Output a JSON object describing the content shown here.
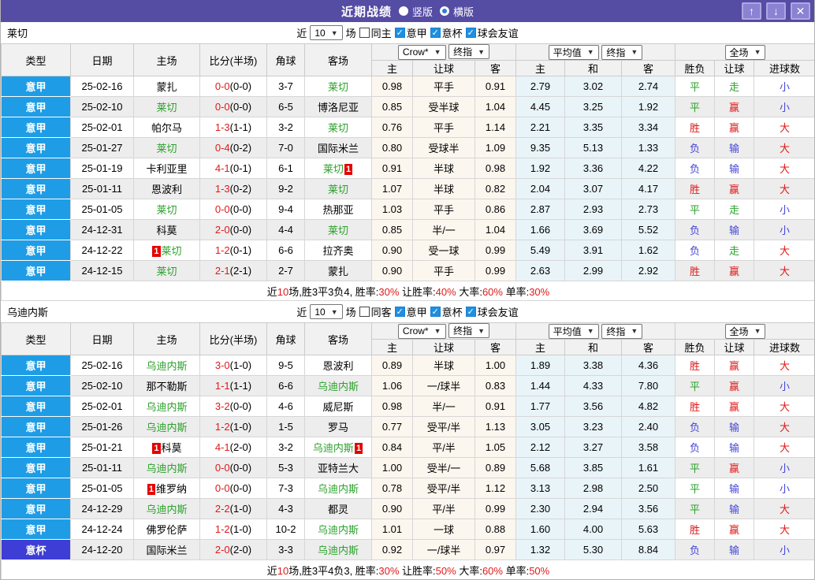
{
  "titlebar": {
    "title": "近期战绩",
    "vertical_label": "竖版",
    "horizontal_label": "横版",
    "icons": {
      "up": "↑",
      "down": "↓",
      "close": "✕"
    },
    "bar_color": "#554ca4",
    "button_color": "#8a82d2"
  },
  "colors": {
    "league_serie_a": "#1e9de6",
    "league_cup": "#3e3ed6",
    "odds_bg": "#fcf7ee",
    "avg_bg": "#e9f4f9",
    "win_red": "#e01919",
    "draw_green": "#2ba12b",
    "lose_blue": "#4545d6"
  },
  "columns": {
    "type": "类型",
    "date": "日期",
    "home": "主场",
    "score": "比分(半场)",
    "corner": "角球",
    "away": "客场",
    "odds_home": "主",
    "handicap": "让球",
    "odds_away": "客",
    "avg_home": "主",
    "avg_draw": "和",
    "avg_away": "客",
    "result": "胜负",
    "handicap_result": "让球",
    "goals": "进球数"
  },
  "tables": [
    {
      "team": "莱切",
      "filter": {
        "near_label": "近",
        "matches_count": "10",
        "games_label": "场",
        "same_venue_label": "同主",
        "leagues": [
          {
            "label": "意甲"
          },
          {
            "label": "意杯"
          },
          {
            "label": "球会友谊"
          }
        ]
      },
      "selects": {
        "company": "Crow*",
        "company_ref": "终指",
        "avg": "平均值",
        "avg_ref": "终指",
        "scope": "全场"
      },
      "rows": [
        {
          "league": "意甲",
          "league_type": "main",
          "date": "25-02-16",
          "home": {
            "name": "蒙扎"
          },
          "score_ft": "0-0",
          "score_ht": "(0-0)",
          "corner": "3-7",
          "away": {
            "name": "莱切",
            "green": true
          },
          "odds": [
            "0.98",
            "平手",
            "0.91"
          ],
          "avg": [
            "2.79",
            "3.02",
            "2.74"
          ],
          "results": [
            {
              "t": "平",
              "c": "green"
            },
            {
              "t": "走",
              "c": "green"
            },
            {
              "t": "小",
              "c": "blue"
            }
          ]
        },
        {
          "league": "意甲",
          "league_type": "main",
          "date": "25-02-10",
          "home": {
            "name": "莱切",
            "green": true
          },
          "score_ft": "0-0",
          "score_ht": "(0-0)",
          "corner": "6-5",
          "away": {
            "name": "博洛尼亚"
          },
          "odds": [
            "0.85",
            "受半球",
            "1.04"
          ],
          "avg": [
            "4.45",
            "3.25",
            "1.92"
          ],
          "results": [
            {
              "t": "平",
              "c": "green"
            },
            {
              "t": "赢",
              "c": "red"
            },
            {
              "t": "小",
              "c": "blue"
            }
          ]
        },
        {
          "league": "意甲",
          "league_type": "main",
          "date": "25-02-01",
          "home": {
            "name": "帕尔马"
          },
          "score_ft": "1-3",
          "score_ht": "(1-1)",
          "corner": "3-2",
          "away": {
            "name": "莱切",
            "green": true
          },
          "odds": [
            "0.76",
            "平手",
            "1.14"
          ],
          "avg": [
            "2.21",
            "3.35",
            "3.34"
          ],
          "results": [
            {
              "t": "胜",
              "c": "red"
            },
            {
              "t": "赢",
              "c": "red"
            },
            {
              "t": "大",
              "c": "red"
            }
          ]
        },
        {
          "league": "意甲",
          "league_type": "main",
          "date": "25-01-27",
          "home": {
            "name": "莱切",
            "green": true
          },
          "score_ft": "0-4",
          "score_ht": "(0-2)",
          "corner": "7-0",
          "away": {
            "name": "国际米兰"
          },
          "odds": [
            "0.80",
            "受球半",
            "1.09"
          ],
          "avg": [
            "9.35",
            "5.13",
            "1.33"
          ],
          "results": [
            {
              "t": "负",
              "c": "blue"
            },
            {
              "t": "输",
              "c": "blue"
            },
            {
              "t": "大",
              "c": "red"
            }
          ]
        },
        {
          "league": "意甲",
          "league_type": "main",
          "date": "25-01-19",
          "home": {
            "name": "卡利亚里"
          },
          "score_ft": "4-1",
          "score_ht": "(0-1)",
          "corner": "6-1",
          "away": {
            "name": "莱切",
            "green": true,
            "card": "1"
          },
          "odds": [
            "0.91",
            "半球",
            "0.98"
          ],
          "avg": [
            "1.92",
            "3.36",
            "4.22"
          ],
          "results": [
            {
              "t": "负",
              "c": "blue"
            },
            {
              "t": "输",
              "c": "blue"
            },
            {
              "t": "大",
              "c": "red"
            }
          ]
        },
        {
          "league": "意甲",
          "league_type": "main",
          "date": "25-01-11",
          "home": {
            "name": "恩波利"
          },
          "score_ft": "1-3",
          "score_ht": "(0-2)",
          "corner": "9-2",
          "away": {
            "name": "莱切",
            "green": true
          },
          "odds": [
            "1.07",
            "半球",
            "0.82"
          ],
          "avg": [
            "2.04",
            "3.07",
            "4.17"
          ],
          "results": [
            {
              "t": "胜",
              "c": "red"
            },
            {
              "t": "赢",
              "c": "red"
            },
            {
              "t": "大",
              "c": "red"
            }
          ]
        },
        {
          "league": "意甲",
          "league_type": "main",
          "date": "25-01-05",
          "home": {
            "name": "莱切",
            "green": true
          },
          "score_ft": "0-0",
          "score_ht": "(0-0)",
          "corner": "9-4",
          "away": {
            "name": "热那亚"
          },
          "odds": [
            "1.03",
            "平手",
            "0.86"
          ],
          "avg": [
            "2.87",
            "2.93",
            "2.73"
          ],
          "results": [
            {
              "t": "平",
              "c": "green"
            },
            {
              "t": "走",
              "c": "green"
            },
            {
              "t": "小",
              "c": "blue"
            }
          ]
        },
        {
          "league": "意甲",
          "league_type": "main",
          "date": "24-12-31",
          "home": {
            "name": "科莫"
          },
          "score_ft": "2-0",
          "score_ht": "(0-0)",
          "corner": "4-4",
          "away": {
            "name": "莱切",
            "green": true
          },
          "odds": [
            "0.85",
            "半/一",
            "1.04"
          ],
          "avg": [
            "1.66",
            "3.69",
            "5.52"
          ],
          "results": [
            {
              "t": "负",
              "c": "blue"
            },
            {
              "t": "输",
              "c": "blue"
            },
            {
              "t": "小",
              "c": "blue"
            }
          ]
        },
        {
          "league": "意甲",
          "league_type": "main",
          "date": "24-12-22",
          "home": {
            "name": "莱切",
            "green": true,
            "card": "1"
          },
          "score_ft": "1-2",
          "score_ht": "(0-1)",
          "corner": "6-6",
          "away": {
            "name": "拉齐奥"
          },
          "odds": [
            "0.90",
            "受一球",
            "0.99"
          ],
          "avg": [
            "5.49",
            "3.91",
            "1.62"
          ],
          "results": [
            {
              "t": "负",
              "c": "blue"
            },
            {
              "t": "走",
              "c": "green"
            },
            {
              "t": "大",
              "c": "red"
            }
          ]
        },
        {
          "league": "意甲",
          "league_type": "main",
          "date": "24-12-15",
          "home": {
            "name": "莱切",
            "green": true
          },
          "score_ft": "2-1",
          "score_ht": "(2-1)",
          "corner": "2-7",
          "away": {
            "name": "蒙扎"
          },
          "odds": [
            "0.90",
            "平手",
            "0.99"
          ],
          "avg": [
            "2.63",
            "2.99",
            "2.92"
          ],
          "results": [
            {
              "t": "胜",
              "c": "red"
            },
            {
              "t": "赢",
              "c": "red"
            },
            {
              "t": "大",
              "c": "red"
            }
          ]
        }
      ],
      "summary": [
        {
          "t": "近"
        },
        {
          "t": "10",
          "red": true
        },
        {
          "t": "场,胜3平3负4, 胜率:"
        },
        {
          "t": "30%",
          "red": true
        },
        {
          "t": " 让胜率:"
        },
        {
          "t": "40%",
          "red": true
        },
        {
          "t": " 大率:"
        },
        {
          "t": "60%",
          "red": true
        },
        {
          "t": " 单率:"
        },
        {
          "t": "30%",
          "red": true
        }
      ]
    },
    {
      "team": "乌迪内斯",
      "filter": {
        "near_label": "近",
        "matches_count": "10",
        "games_label": "场",
        "same_venue_label": "同客",
        "leagues": [
          {
            "label": "意甲"
          },
          {
            "label": "意杯"
          },
          {
            "label": "球会友谊"
          }
        ]
      },
      "selects": {
        "company": "Crow*",
        "company_ref": "终指",
        "avg": "平均值",
        "avg_ref": "终指",
        "scope": "全场"
      },
      "rows": [
        {
          "league": "意甲",
          "league_type": "main",
          "date": "25-02-16",
          "home": {
            "name": "乌迪内斯",
            "green": true
          },
          "score_ft": "3-0",
          "score_ht": "(1-0)",
          "corner": "9-5",
          "away": {
            "name": "恩波利"
          },
          "odds": [
            "0.89",
            "半球",
            "1.00"
          ],
          "avg": [
            "1.89",
            "3.38",
            "4.36"
          ],
          "results": [
            {
              "t": "胜",
              "c": "red"
            },
            {
              "t": "赢",
              "c": "red"
            },
            {
              "t": "大",
              "c": "red"
            }
          ]
        },
        {
          "league": "意甲",
          "league_type": "main",
          "date": "25-02-10",
          "home": {
            "name": "那不勒斯"
          },
          "score_ft": "1-1",
          "score_ht": "(1-1)",
          "corner": "6-6",
          "away": {
            "name": "乌迪内斯",
            "green": true
          },
          "odds": [
            "1.06",
            "一/球半",
            "0.83"
          ],
          "avg": [
            "1.44",
            "4.33",
            "7.80"
          ],
          "results": [
            {
              "t": "平",
              "c": "green"
            },
            {
              "t": "赢",
              "c": "red"
            },
            {
              "t": "小",
              "c": "blue"
            }
          ]
        },
        {
          "league": "意甲",
          "league_type": "main",
          "date": "25-02-01",
          "home": {
            "name": "乌迪内斯",
            "green": true
          },
          "score_ft": "3-2",
          "score_ht": "(0-0)",
          "corner": "4-6",
          "away": {
            "name": "威尼斯"
          },
          "odds": [
            "0.98",
            "半/一",
            "0.91"
          ],
          "avg": [
            "1.77",
            "3.56",
            "4.82"
          ],
          "results": [
            {
              "t": "胜",
              "c": "red"
            },
            {
              "t": "赢",
              "c": "red"
            },
            {
              "t": "大",
              "c": "red"
            }
          ]
        },
        {
          "league": "意甲",
          "league_type": "main",
          "date": "25-01-26",
          "home": {
            "name": "乌迪内斯",
            "green": true
          },
          "score_ft": "1-2",
          "score_ht": "(1-0)",
          "corner": "1-5",
          "away": {
            "name": "罗马"
          },
          "odds": [
            "0.77",
            "受平/半",
            "1.13"
          ],
          "avg": [
            "3.05",
            "3.23",
            "2.40"
          ],
          "results": [
            {
              "t": "负",
              "c": "blue"
            },
            {
              "t": "输",
              "c": "blue"
            },
            {
              "t": "大",
              "c": "red"
            }
          ]
        },
        {
          "league": "意甲",
          "league_type": "main",
          "date": "25-01-21",
          "home": {
            "name": "科莫",
            "card": "1"
          },
          "score_ft": "4-1",
          "score_ht": "(2-0)",
          "corner": "3-2",
          "away": {
            "name": "乌迪内斯",
            "green": true,
            "card": "1"
          },
          "odds": [
            "0.84",
            "平/半",
            "1.05"
          ],
          "avg": [
            "2.12",
            "3.27",
            "3.58"
          ],
          "results": [
            {
              "t": "负",
              "c": "blue"
            },
            {
              "t": "输",
              "c": "blue"
            },
            {
              "t": "大",
              "c": "red"
            }
          ]
        },
        {
          "league": "意甲",
          "league_type": "main",
          "date": "25-01-11",
          "home": {
            "name": "乌迪内斯",
            "green": true
          },
          "score_ft": "0-0",
          "score_ht": "(0-0)",
          "corner": "5-3",
          "away": {
            "name": "亚特兰大"
          },
          "odds": [
            "1.00",
            "受半/一",
            "0.89"
          ],
          "avg": [
            "5.68",
            "3.85",
            "1.61"
          ],
          "results": [
            {
              "t": "平",
              "c": "green"
            },
            {
              "t": "赢",
              "c": "red"
            },
            {
              "t": "小",
              "c": "blue"
            }
          ]
        },
        {
          "league": "意甲",
          "league_type": "main",
          "date": "25-01-05",
          "home": {
            "name": "维罗纳",
            "card": "1"
          },
          "score_ft": "0-0",
          "score_ht": "(0-0)",
          "corner": "7-3",
          "away": {
            "name": "乌迪内斯",
            "green": true
          },
          "odds": [
            "0.78",
            "受平/半",
            "1.12"
          ],
          "avg": [
            "3.13",
            "2.98",
            "2.50"
          ],
          "results": [
            {
              "t": "平",
              "c": "green"
            },
            {
              "t": "输",
              "c": "blue"
            },
            {
              "t": "小",
              "c": "blue"
            }
          ]
        },
        {
          "league": "意甲",
          "league_type": "main",
          "date": "24-12-29",
          "home": {
            "name": "乌迪内斯",
            "green": true
          },
          "score_ft": "2-2",
          "score_ht": "(1-0)",
          "corner": "4-3",
          "away": {
            "name": "都灵"
          },
          "odds": [
            "0.90",
            "平/半",
            "0.99"
          ],
          "avg": [
            "2.30",
            "2.94",
            "3.56"
          ],
          "results": [
            {
              "t": "平",
              "c": "green"
            },
            {
              "t": "输",
              "c": "blue"
            },
            {
              "t": "大",
              "c": "red"
            }
          ]
        },
        {
          "league": "意甲",
          "league_type": "main",
          "date": "24-12-24",
          "home": {
            "name": "佛罗伦萨"
          },
          "score_ft": "1-2",
          "score_ht": "(1-0)",
          "corner": "10-2",
          "away": {
            "name": "乌迪内斯",
            "green": true
          },
          "odds": [
            "1.01",
            "一球",
            "0.88"
          ],
          "avg": [
            "1.60",
            "4.00",
            "5.63"
          ],
          "results": [
            {
              "t": "胜",
              "c": "red"
            },
            {
              "t": "赢",
              "c": "red"
            },
            {
              "t": "大",
              "c": "red"
            }
          ]
        },
        {
          "league": "意杯",
          "league_type": "cup",
          "date": "24-12-20",
          "home": {
            "name": "国际米兰"
          },
          "score_ft": "2-0",
          "score_ht": "(2-0)",
          "corner": "3-3",
          "away": {
            "name": "乌迪内斯",
            "green": true
          },
          "odds": [
            "0.92",
            "一/球半",
            "0.97"
          ],
          "avg": [
            "1.32",
            "5.30",
            "8.84"
          ],
          "results": [
            {
              "t": "负",
              "c": "blue"
            },
            {
              "t": "输",
              "c": "blue"
            },
            {
              "t": "小",
              "c": "blue"
            }
          ]
        }
      ],
      "summary": [
        {
          "t": "近"
        },
        {
          "t": "10",
          "red": true
        },
        {
          "t": "场,胜3平4负3, 胜率:"
        },
        {
          "t": "30%",
          "red": true
        },
        {
          "t": " 让胜率:"
        },
        {
          "t": "50%",
          "red": true
        },
        {
          "t": " 大率:"
        },
        {
          "t": "60%",
          "red": true
        },
        {
          "t": " 单率:"
        },
        {
          "t": "50%",
          "red": true
        }
      ]
    }
  ]
}
